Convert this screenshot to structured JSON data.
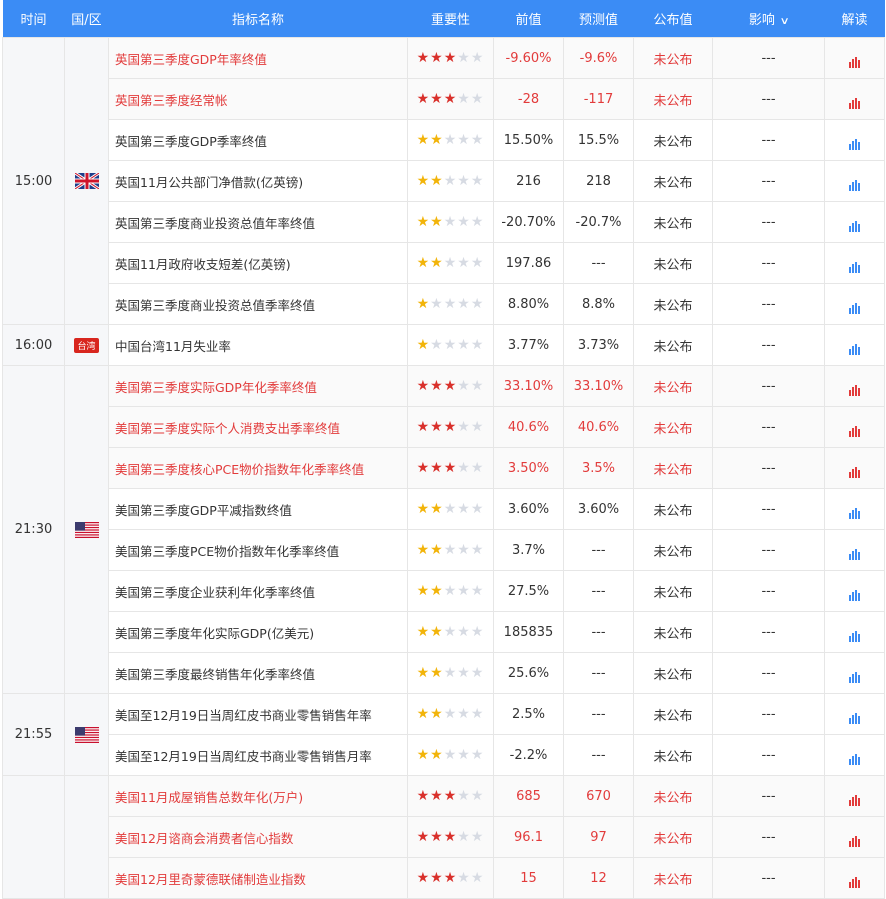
{
  "header": {
    "time": "时间",
    "region": "国/区",
    "indicator": "指标名称",
    "importance": "重要性",
    "previous": "前值",
    "forecast": "预测值",
    "actual": "公布值",
    "impact": "影响",
    "analysis": "解读"
  },
  "groups": [
    {
      "time": "15:00",
      "flag": "uk",
      "rows": [
        {
          "name": "英国第三季度GDP年率终值",
          "stars": 3,
          "prev": "-9.60%",
          "fc": "-9.6%",
          "status": "未公布",
          "impact": "---",
          "hi": true
        },
        {
          "name": "英国第三季度经常帐",
          "stars": 3,
          "prev": "-28",
          "fc": "-117",
          "status": "未公布",
          "impact": "---",
          "hi": true
        },
        {
          "name": "英国第三季度GDP季率终值",
          "stars": 2,
          "prev": "15.50%",
          "fc": "15.5%",
          "status": "未公布",
          "impact": "---",
          "hi": false
        },
        {
          "name": "英国11月公共部门净借款(亿英镑)",
          "stars": 2,
          "prev": "216",
          "fc": "218",
          "status": "未公布",
          "impact": "---",
          "hi": false
        },
        {
          "name": "英国第三季度商业投资总值年率终值",
          "stars": 2,
          "prev": "-20.70%",
          "fc": "-20.7%",
          "status": "未公布",
          "impact": "---",
          "hi": false
        },
        {
          "name": "英国11月政府收支短差(亿英镑)",
          "stars": 2,
          "prev": "197.86",
          "fc": "---",
          "status": "未公布",
          "impact": "---",
          "hi": false
        },
        {
          "name": "英国第三季度商业投资总值季率终值",
          "stars": 1,
          "prev": "8.80%",
          "fc": "8.8%",
          "status": "未公布",
          "impact": "---",
          "hi": false
        }
      ]
    },
    {
      "time": "16:00",
      "flag": "tw",
      "flag_label": "台湾",
      "rows": [
        {
          "name": "中国台湾11月失业率",
          "stars": 1,
          "prev": "3.77%",
          "fc": "3.73%",
          "status": "未公布",
          "impact": "---",
          "hi": false
        }
      ]
    },
    {
      "time": "21:30",
      "flag": "us",
      "rows": [
        {
          "name": "美国第三季度实际GDP年化季率终值",
          "stars": 3,
          "prev": "33.10%",
          "fc": "33.10%",
          "status": "未公布",
          "impact": "---",
          "hi": true
        },
        {
          "name": "美国第三季度实际个人消费支出季率终值",
          "stars": 3,
          "prev": "40.6%",
          "fc": "40.6%",
          "status": "未公布",
          "impact": "---",
          "hi": true
        },
        {
          "name": "美国第三季度核心PCE物价指数年化季率终值",
          "stars": 3,
          "prev": "3.50%",
          "fc": "3.5%",
          "status": "未公布",
          "impact": "---",
          "hi": true
        },
        {
          "name": "美国第三季度GDP平减指数终值",
          "stars": 2,
          "prev": "3.60%",
          "fc": "3.60%",
          "status": "未公布",
          "impact": "---",
          "hi": false
        },
        {
          "name": "美国第三季度PCE物价指数年化季率终值",
          "stars": 2,
          "prev": "3.7%",
          "fc": "---",
          "status": "未公布",
          "impact": "---",
          "hi": false
        },
        {
          "name": "美国第三季度企业获利年化季率终值",
          "stars": 2,
          "prev": "27.5%",
          "fc": "---",
          "status": "未公布",
          "impact": "---",
          "hi": false
        },
        {
          "name": "美国第三季度年化实际GDP(亿美元)",
          "stars": 2,
          "prev": "185835",
          "fc": "---",
          "status": "未公布",
          "impact": "---",
          "hi": false
        },
        {
          "name": "美国第三季度最终销售年化季率终值",
          "stars": 2,
          "prev": "25.6%",
          "fc": "---",
          "status": "未公布",
          "impact": "---",
          "hi": false
        }
      ]
    },
    {
      "time": "21:55",
      "flag": "us",
      "rows": [
        {
          "name": "美国至12月19日当周红皮书商业零售销售年率",
          "stars": 2,
          "prev": "2.5%",
          "fc": "---",
          "status": "未公布",
          "impact": "---",
          "hi": false
        },
        {
          "name": "美国至12月19日当周红皮书商业零售销售月率",
          "stars": 2,
          "prev": "-2.2%",
          "fc": "---",
          "status": "未公布",
          "impact": "---",
          "hi": false
        }
      ]
    },
    {
      "time": "",
      "flag": "",
      "rows": [
        {
          "name": "美国11月成屋销售总数年化(万户)",
          "stars": 3,
          "prev": "685",
          "fc": "670",
          "status": "未公布",
          "impact": "---",
          "hi": true
        },
        {
          "name": "美国12月谘商会消费者信心指数",
          "stars": 3,
          "prev": "96.1",
          "fc": "97",
          "status": "未公布",
          "impact": "---",
          "hi": true
        },
        {
          "name": "美国12月里奇蒙德联储制造业指数",
          "stars": 3,
          "prev": "15",
          "fc": "12",
          "status": "未公布",
          "impact": "---",
          "hi": true
        }
      ]
    }
  ],
  "colors": {
    "header_bg": "#3b8cf5",
    "high": "#e23b3b",
    "star_high": "#d9302b",
    "star_mid": "#f2b40a",
    "icon_blue": "#3b8cf5"
  }
}
